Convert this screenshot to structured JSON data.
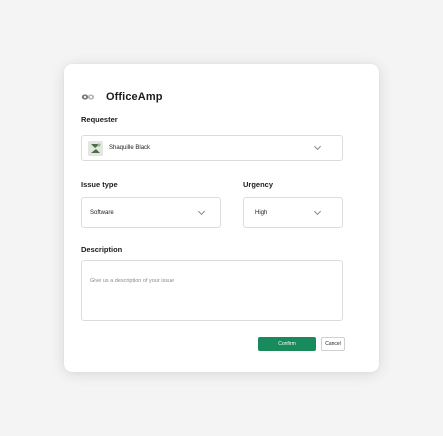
{
  "app": {
    "title": "OfficeAmp",
    "logo_icon": "officeamp-logo-icon"
  },
  "requester": {
    "label": "Requester",
    "value": "Shaquille Black",
    "avatar_icon": "user-avatar"
  },
  "issue_type": {
    "label": "Issue type",
    "value": "Software"
  },
  "urgency": {
    "label": "Urgency",
    "value": "High"
  },
  "description": {
    "label": "Description",
    "placeholder": "Give us a description of your issue",
    "value": ""
  },
  "actions": {
    "confirm_label": "Confirm",
    "cancel_label": "Cancel"
  },
  "colors": {
    "primary": "#188a5c",
    "border": "#dcdcdc",
    "background": "#f4f4f4",
    "card": "#ffffff"
  }
}
